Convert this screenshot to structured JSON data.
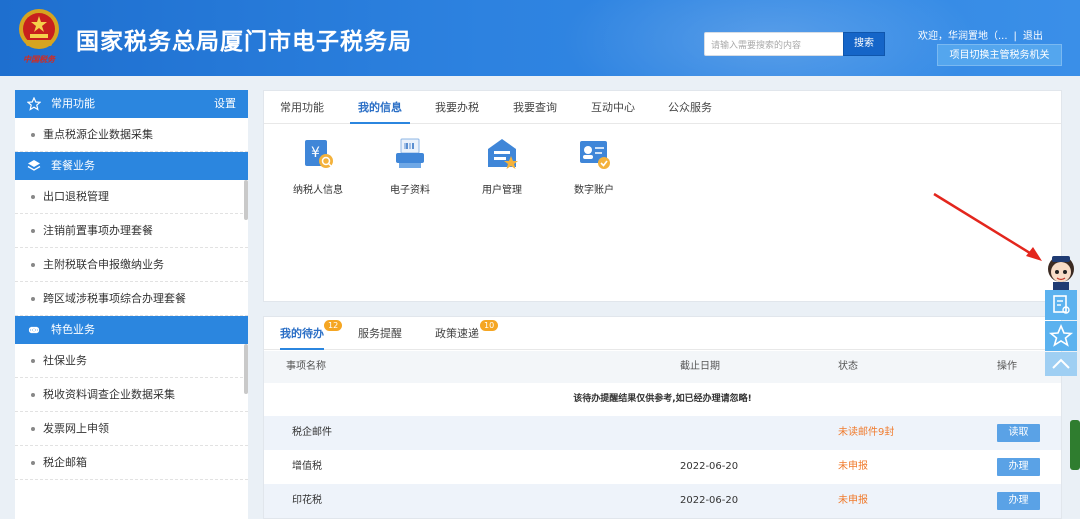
{
  "header": {
    "emblem_text": "中国税务",
    "title": "国家税务总局厦门市电子税务局",
    "search_placeholder": "请输入需要搜索的内容",
    "search_button": "搜索",
    "welcome": "欢迎，华润置地（...",
    "separator": "|",
    "logout": "退出",
    "switch_button": "项目切换主管税务机关"
  },
  "sidebar": {
    "section1": {
      "title": "常用功能",
      "action": "设置",
      "icon": "star-icon",
      "items": [
        "重点税源企业数据采集"
      ]
    },
    "section2": {
      "title": "套餐业务",
      "icon": "layers-icon",
      "items": [
        "出口退税管理",
        "注销前置事项办理套餐",
        "主附税联合申报缴纳业务",
        "跨区域涉税事项综合办理套餐"
      ]
    },
    "section3": {
      "title": "特色业务",
      "icon": "command-icon",
      "items": [
        "社保业务",
        "税收资料调查企业数据采集",
        "发票网上申领",
        "税企邮箱"
      ]
    }
  },
  "main_tabs": [
    "常用功能",
    "我的信息",
    "我要办税",
    "我要查询",
    "互动中心",
    "公众服务"
  ],
  "active_main_tab": "我的信息",
  "tiles": [
    {
      "label": "纳税人信息",
      "icon": "taxpayer-info-icon"
    },
    {
      "label": "电子资料",
      "icon": "electronic-docs-icon"
    },
    {
      "label": "用户管理",
      "icon": "user-management-icon"
    },
    {
      "label": "数字账户",
      "icon": "digital-account-icon"
    }
  ],
  "todo": {
    "tabs": [
      {
        "label": "我的待办",
        "badge": "12"
      },
      {
        "label": "服务提醒",
        "badge": ""
      },
      {
        "label": "政策速递",
        "badge": "10"
      }
    ],
    "columns": [
      "事项名称",
      "截止日期",
      "状态",
      "操作"
    ],
    "notice": "该待办提醒结果仅供参考,如已经办理请忽略!",
    "rows": [
      {
        "name": "税企邮件",
        "deadline": "",
        "status": "未读邮件9封",
        "action": "读取"
      },
      {
        "name": "增值税",
        "deadline": "2022-06-20",
        "status": "未申报",
        "action": "办理"
      },
      {
        "name": "印花税",
        "deadline": "2022-06-20",
        "status": "未申报",
        "action": "办理"
      }
    ]
  },
  "colors": {
    "header_blue": "#2d82e0",
    "accent_blue": "#2b86df",
    "status_orange": "#f07b2d",
    "badge_orange": "#f5a623"
  },
  "float_tools": [
    "assistant-avatar-icon",
    "document-icon",
    "star-outline-icon",
    "chevron-up-icon"
  ]
}
